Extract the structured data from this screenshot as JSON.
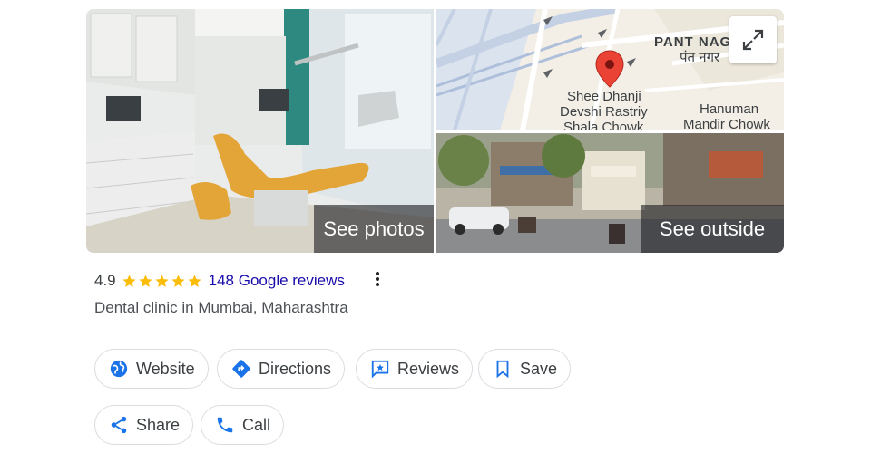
{
  "photos": {
    "see_photos_label": "See photos",
    "see_outside_label": "See outside"
  },
  "map": {
    "labels": {
      "pant_nagar_en": "PANT NAGAR",
      "pant_nagar_local": "पंत नगर",
      "landmark_line1": "Shee Dhanji",
      "landmark_line2": "Devshi Rastriy",
      "landmark_line3": "Shala Chowk",
      "hanuman_line1": "Hanuman",
      "hanuman_line2": "Mandir Chowk"
    },
    "pin_color": "#ea4335"
  },
  "business": {
    "rating": "4.9",
    "stars": 5,
    "reviews_label": "148 Google reviews",
    "category": "Dental clinic in Mumbai, Maharashtra"
  },
  "actions": {
    "website": "Website",
    "directions": "Directions",
    "reviews": "Reviews",
    "save": "Save",
    "share": "Share",
    "call": "Call"
  },
  "colors": {
    "accent": "#1a73e8",
    "star": "#fbbc04",
    "link": "#1a0dab"
  }
}
